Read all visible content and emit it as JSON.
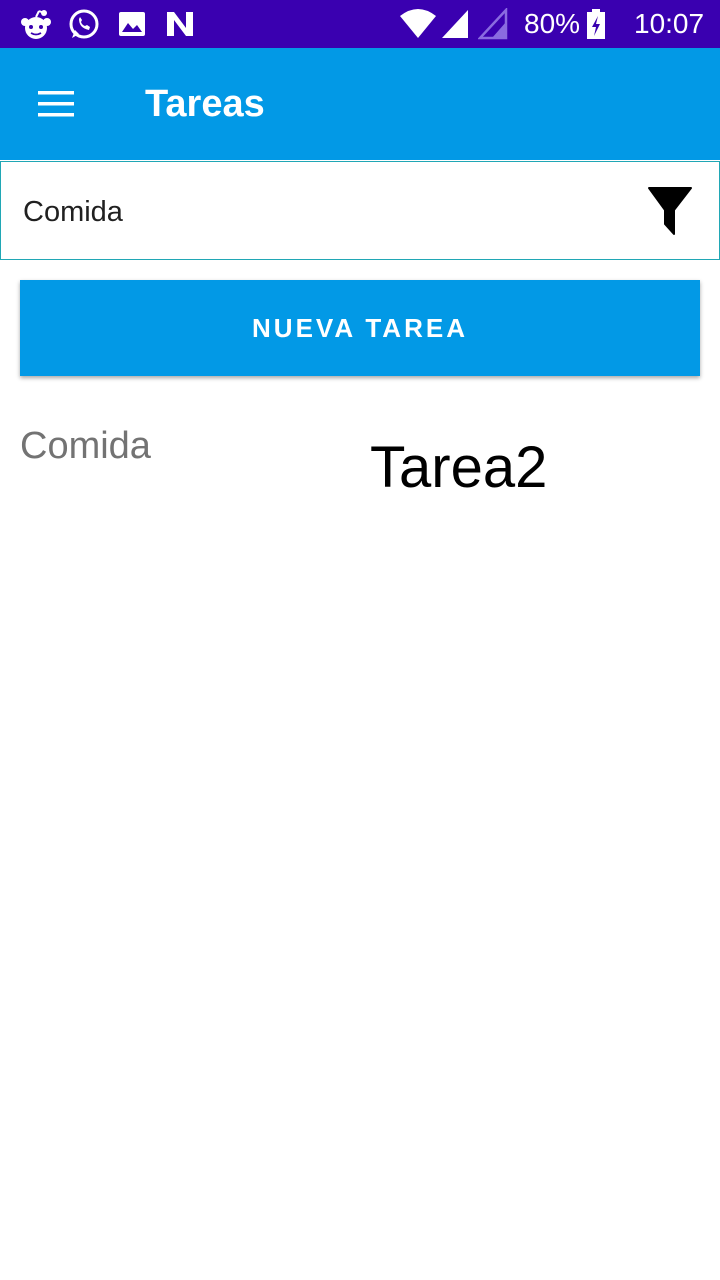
{
  "status_bar": {
    "icons_left": [
      "reddit-icon",
      "whatsapp-icon",
      "image-icon",
      "n-notification-icon"
    ],
    "icons_right": [
      "wifi-icon",
      "signal-icon",
      "signal-empty-icon",
      "battery-charging-icon"
    ],
    "battery": "80%",
    "time": "10:07",
    "color": "#3a00b0"
  },
  "app_bar": {
    "title": "Tareas",
    "menu_icon": "hamburger-menu-icon",
    "color": "#0299e6"
  },
  "filter": {
    "value": "Comida",
    "icon": "filter-icon"
  },
  "new_task_button": {
    "label": "NUEVA TAREA",
    "color": "#0299e6"
  },
  "tasks": [
    {
      "category": "Comida",
      "name": "Tarea2"
    }
  ]
}
